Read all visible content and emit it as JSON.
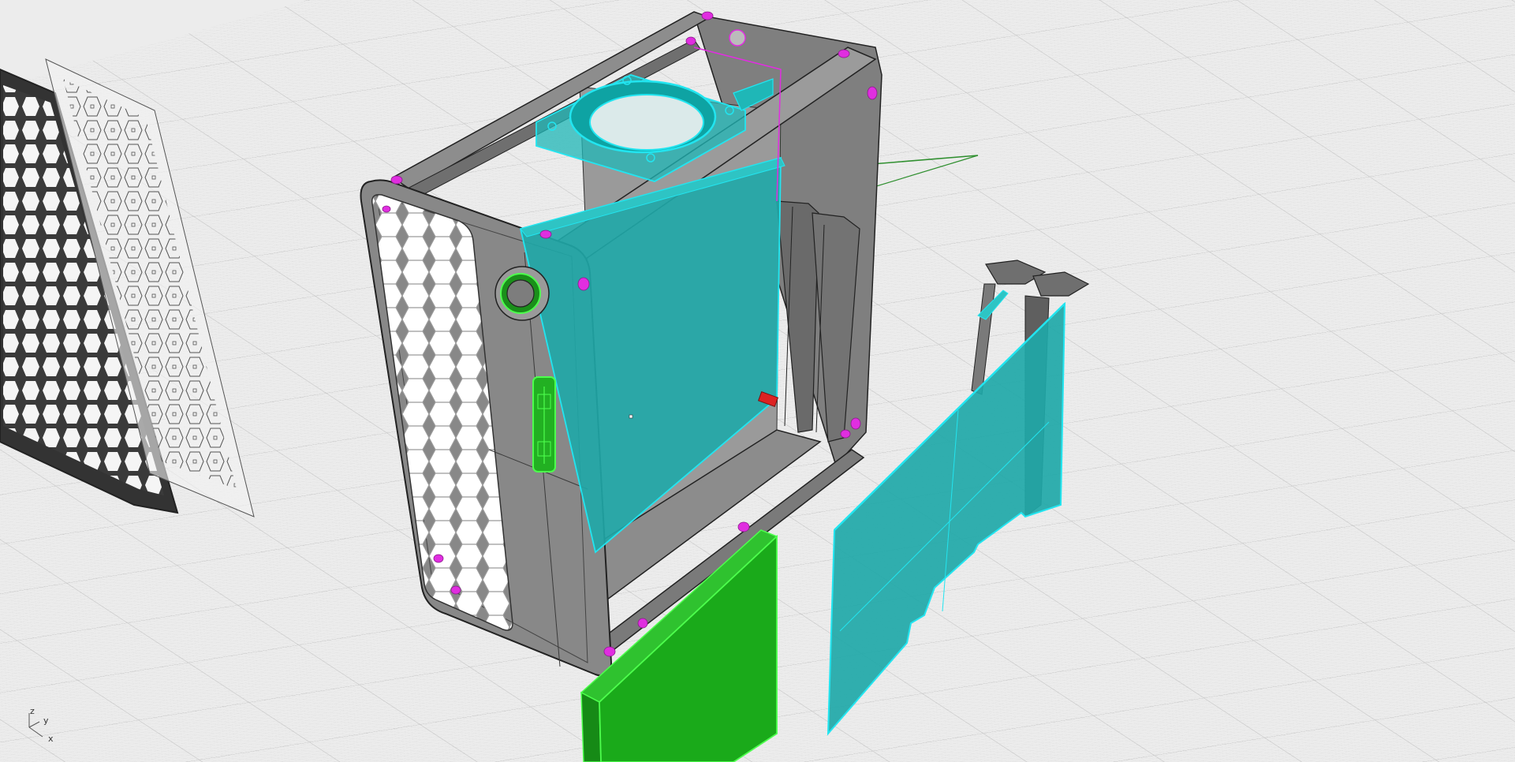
{
  "viewport": {
    "name": "Perspective",
    "axis_widget": {
      "z": "z",
      "y": "y",
      "x": "x"
    }
  },
  "colors": {
    "background": "#ececec",
    "grid_minor": "#d4d4d4",
    "grid_major": "#c2c2c2",
    "y_axis": "#2f8f2f",
    "case_body": "#8a8a8a",
    "case_dark": "#6e6e6e",
    "selection_cyan": "#27b3b3",
    "selection_edge": "#22e5f0",
    "selected_green": "#1aaa1a",
    "green_edge": "#4dff4d",
    "magenta_point": "#e02ee0",
    "red_marker": "#dd2222"
  },
  "objects": [
    {
      "name": "mesh-panel-dark",
      "selected": false
    },
    {
      "name": "mesh-panel-wireframe",
      "selected": false
    },
    {
      "name": "case-enclosure",
      "selected": false
    },
    {
      "name": "case-fan",
      "selected": true
    },
    {
      "name": "motherboard-panel",
      "selected": true
    },
    {
      "name": "psu-block",
      "selected": true
    },
    {
      "name": "gpu-card",
      "selected": true
    },
    {
      "name": "power-button",
      "selected": true
    },
    {
      "name": "usb-ports",
      "selected": true
    }
  ]
}
